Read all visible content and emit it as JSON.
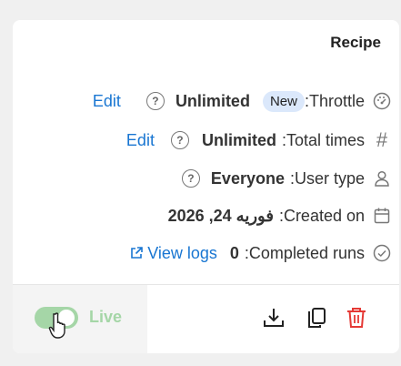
{
  "card": {
    "title": "Recipe"
  },
  "throttle": {
    "label": ":Throttle",
    "badge": "New",
    "value": "Unlimited",
    "edit": "Edit",
    "icon": "gauge-icon"
  },
  "total_times": {
    "label": ":Total times",
    "value": "Unlimited",
    "edit": "Edit",
    "icon": "hash-icon"
  },
  "user_type": {
    "label": ":User type",
    "value": "Everyone",
    "icon": "user-icon"
  },
  "created_on": {
    "label": ":Created on",
    "value": "فوريه 24, 2026",
    "icon": "calendar-icon"
  },
  "completed_runs": {
    "label": ":Completed runs",
    "value": "0",
    "link": "View logs",
    "icon": "check-circle-icon"
  },
  "footer": {
    "live_label": "Live",
    "live_on": true,
    "download_icon": "download-icon",
    "copy_icon": "copy-icon",
    "delete_icon": "trash-icon"
  },
  "colors": {
    "link": "#1976d2",
    "live": "#a5d6a7",
    "delete": "#e53935",
    "badge_bg": "#dbe8fb"
  }
}
